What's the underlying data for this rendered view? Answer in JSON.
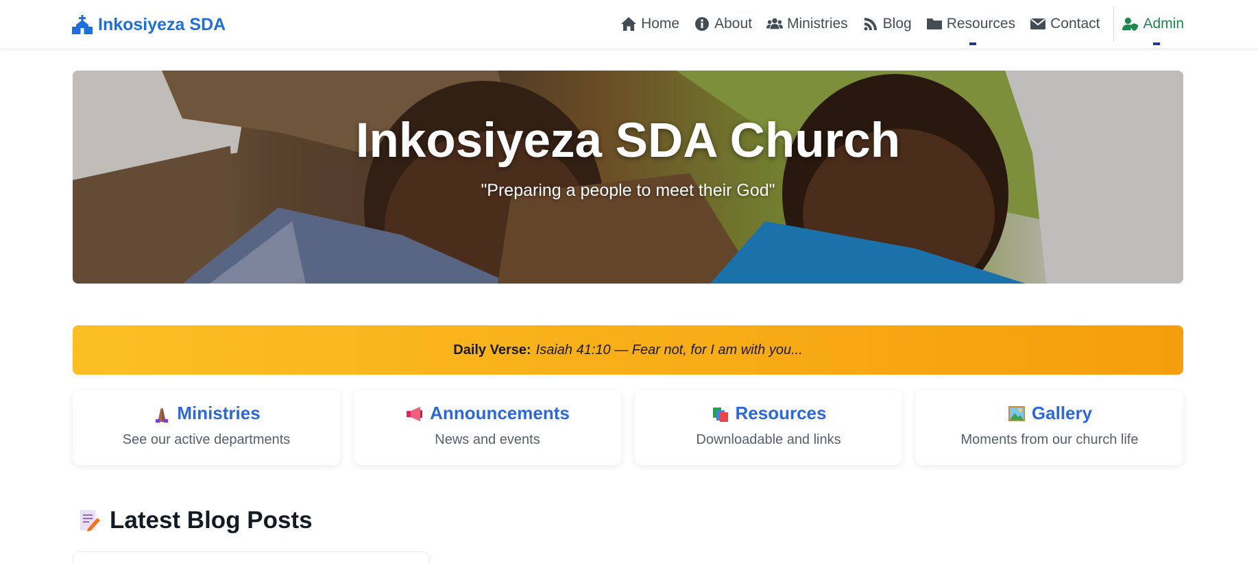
{
  "brand": {
    "name": "Inkosiyeza SDA",
    "icon": "church-icon",
    "color": "#1d6fe0"
  },
  "nav": {
    "items": [
      {
        "label": "Home",
        "icon": "home-icon"
      },
      {
        "label": "About",
        "icon": "info-icon"
      },
      {
        "label": "Ministries",
        "icon": "users-icon"
      },
      {
        "label": "Blog",
        "icon": "blog-icon"
      },
      {
        "label": "Resources",
        "icon": "folder-icon"
      },
      {
        "label": "Contact",
        "icon": "envelope-icon"
      }
    ],
    "admin": {
      "label": "Admin",
      "icon": "user-shield-icon",
      "color": "#1a8a4a"
    }
  },
  "hero": {
    "title": "Inkosiyeza SDA Church",
    "subtitle": "\"Preparing a people to meet their God\""
  },
  "verse": {
    "label": "Daily Verse:",
    "text": "Isaiah 41:10 — Fear not, for I am with you..."
  },
  "cards": [
    {
      "title": "Ministries",
      "subtitle": "See our active departments",
      "icon": "praying-hands-icon"
    },
    {
      "title": "Announcements",
      "subtitle": "News and events",
      "icon": "megaphone-icon"
    },
    {
      "title": "Resources",
      "subtitle": "Downloadable and links",
      "icon": "books-icon"
    },
    {
      "title": "Gallery",
      "subtitle": "Moments from our church life",
      "icon": "picture-icon"
    }
  ],
  "blog": {
    "heading": "Latest Blog Posts",
    "icon": "memo-icon"
  },
  "colors": {
    "accent": "#2b67e0",
    "verse_start": "#fbbf24",
    "verse_end": "#f59e0b"
  }
}
